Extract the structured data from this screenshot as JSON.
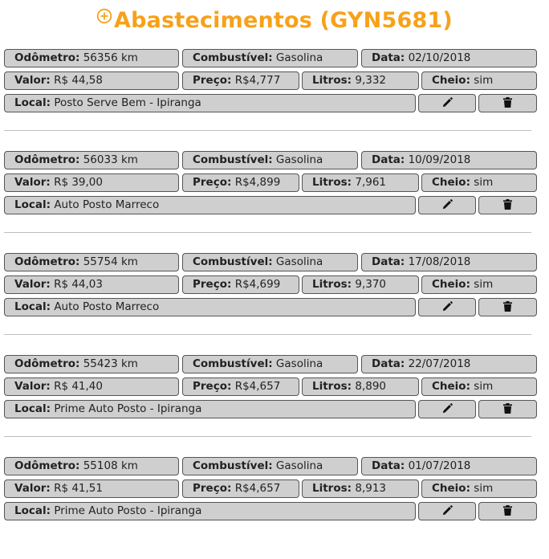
{
  "header": {
    "title": "Abastecimentos (GYN5681)",
    "add_icon": "plus-circle-icon"
  },
  "labels": {
    "odometro": "Odômetro:",
    "combustivel": "Combustível:",
    "data": "Data:",
    "valor": "Valor:",
    "preco": "Preço:",
    "litros": "Litros:",
    "cheio": "Cheio:",
    "local": "Local:"
  },
  "icons": {
    "edit": "pencil-icon",
    "delete": "trash-icon"
  },
  "colors": {
    "title": "#f7a11a",
    "box_bg": "#cfcfcf"
  },
  "entries": [
    {
      "odometro": "56356 km",
      "combustivel": "Gasolina",
      "data": "02/10/2018",
      "valor": "R$ 44,58",
      "preco": "R$4,777",
      "litros": "9,332",
      "cheio": "sim",
      "local": "Posto Serve Bem - Ipiranga"
    },
    {
      "odometro": "56033 km",
      "combustivel": "Gasolina",
      "data": "10/09/2018",
      "valor": "R$ 39,00",
      "preco": "R$4,899",
      "litros": "7,961",
      "cheio": "sim",
      "local": "Auto Posto Marreco"
    },
    {
      "odometro": "55754 km",
      "combustivel": "Gasolina",
      "data": "17/08/2018",
      "valor": "R$ 44,03",
      "preco": "R$4,699",
      "litros": "9,370",
      "cheio": "sim",
      "local": "Auto Posto Marreco"
    },
    {
      "odometro": "55423 km",
      "combustivel": "Gasolina",
      "data": "22/07/2018",
      "valor": "R$ 41,40",
      "preco": "R$4,657",
      "litros": "8,890",
      "cheio": "sim",
      "local": "Prime Auto Posto - Ipiranga"
    },
    {
      "odometro": "55108 km",
      "combustivel": "Gasolina",
      "data": "01/07/2018",
      "valor": "R$ 41,51",
      "preco": "R$4,657",
      "litros": "8,913",
      "cheio": "sim",
      "local": "Prime Auto Posto - Ipiranga"
    }
  ]
}
